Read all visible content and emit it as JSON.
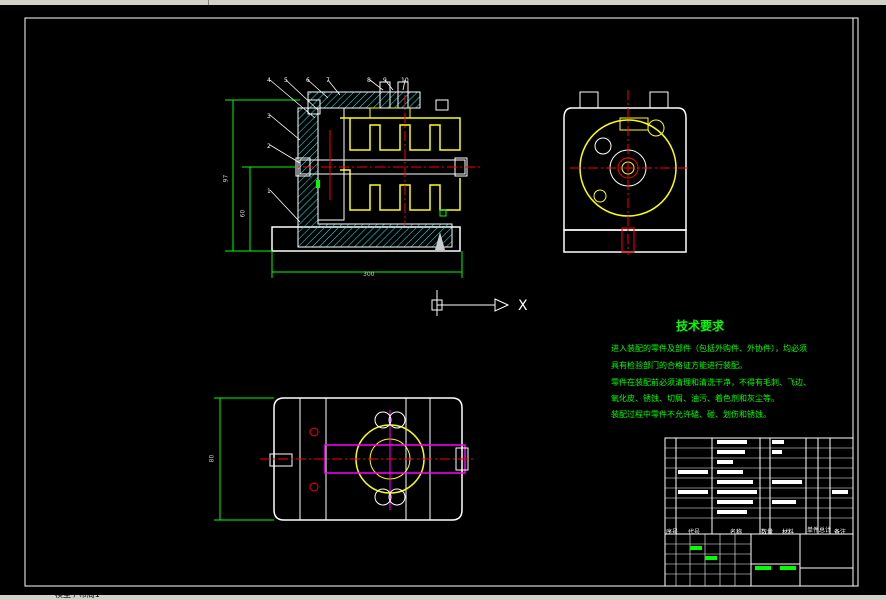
{
  "app": {
    "status_label": "模型 / 布局1"
  },
  "drawing": {
    "axis_label": "X",
    "tech_requirements": {
      "title": "技术要求",
      "lines": [
        "进入装配的零件及部件（包括外购件、外协件），均必须",
        "具有检验部门的合格证方能进行装配。",
        "零件在装配前必须清理和清洗干净，不得有毛刺、飞边、",
        "氧化皮、锈蚀、切屑、油污、着色剂和灰尘等。",
        "装配过程中零件不允许磕、碰、划伤和锈蚀。"
      ]
    },
    "dimensions": {
      "overall_height": "97",
      "base_height": "60",
      "base_width": "300",
      "plan_height": "80"
    },
    "balloons": [
      "1",
      "2",
      "3",
      "4",
      "5",
      "6",
      "7",
      "8",
      "9",
      "10"
    ],
    "title_block": {
      "headers": [
        "序号",
        "代号",
        "名称",
        "数量",
        "材料",
        "单件",
        "总计",
        "备注"
      ]
    },
    "colors": {
      "outline": "#ffffff",
      "green": "#00ff00",
      "yellow": "#ffff00",
      "red": "#ff0000",
      "magenta": "#ff00ff",
      "cyan": "#00ffff"
    }
  }
}
